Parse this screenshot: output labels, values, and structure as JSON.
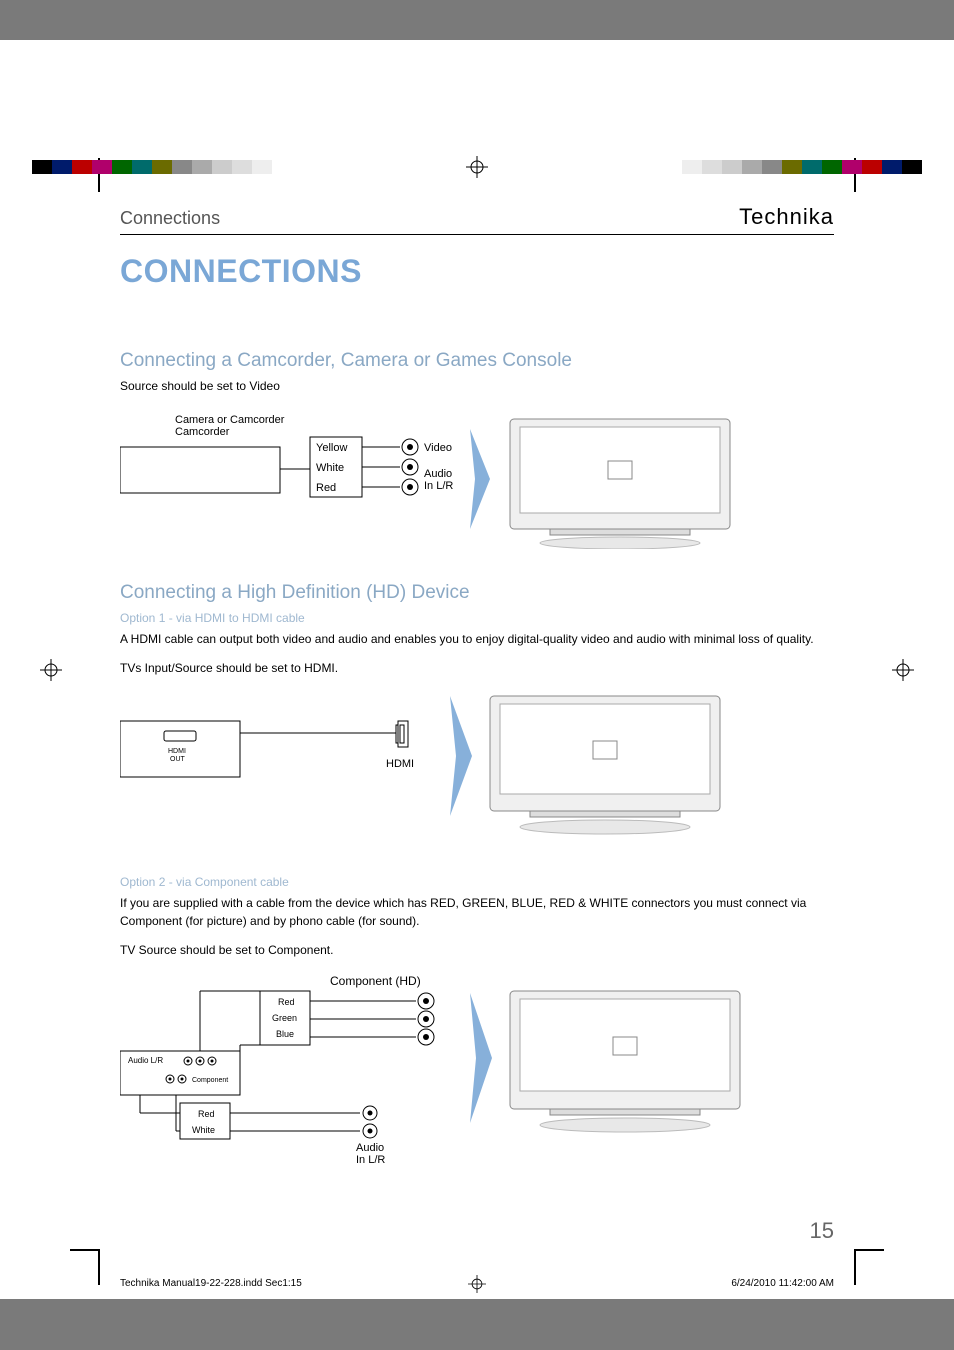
{
  "header": {
    "section_label": "Connections",
    "brand": "Technika"
  },
  "title": "CONNECTIONS",
  "section1": {
    "heading": "Connecting a Camcorder, Camera or Games Console",
    "source_note": "Source should be set to Video",
    "labels": {
      "device": "Camera or Camcorder",
      "yellow": "Yellow",
      "white": "White",
      "red": "Red",
      "video": "Video",
      "audio": "Audio In L/R"
    }
  },
  "section2": {
    "heading": "Connecting a High Definition (HD) Device",
    "option1_prefix": "Option 1 - ",
    "option1_suffix": "via HDMI to HDMI cable",
    "hdmi_desc": "A HDMI cable can output both video and audio and enables you to enjoy digital-quality video and audio with minimal loss of quality.",
    "hdmi_source": "TVs Input/Source should be set to HDMI.",
    "labels": {
      "hdmi_out": "HDMI OUT",
      "hdmi": "HDMI"
    }
  },
  "section3": {
    "option2_prefix": "Option 2 - ",
    "option2_suffix": "via Component cable",
    "component_desc": "If you are supplied with a cable from the device which has RED, GREEN, BLUE, RED & WHITE connectors you must connect via Component (for picture) and by phono cable (for sound).",
    "component_source": "TV Source should be set to Component.",
    "labels": {
      "component_hd": "Component (HD)",
      "red": "Red",
      "green": "Green",
      "blue": "Blue",
      "white": "White",
      "audio_lr": "Audio L/R",
      "component": "Component",
      "audio_in": "Audio In L/R"
    }
  },
  "page_number": "15",
  "footer": {
    "file": "Technika Manual19-22-228.indd   Sec1:15",
    "timestamp": "6/24/2010   11:42:00 AM"
  }
}
